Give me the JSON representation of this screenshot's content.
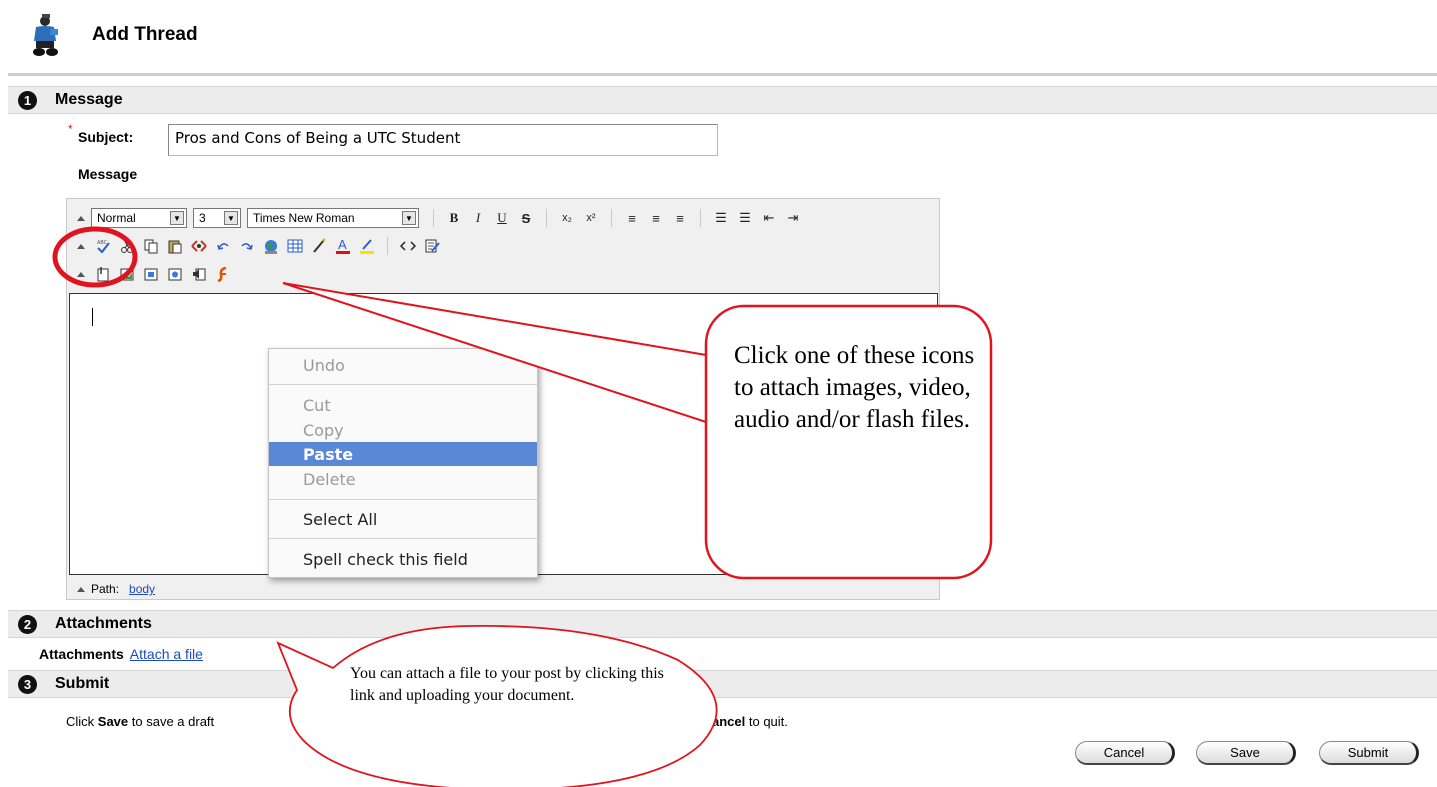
{
  "header": {
    "title": "Add Thread"
  },
  "sections": {
    "message": {
      "number": "1",
      "title": "Message"
    },
    "attachments": {
      "number": "2",
      "title": "Attachments"
    },
    "submit": {
      "number": "3",
      "title": "Submit"
    }
  },
  "subject": {
    "required_mark": "*",
    "label": "Subject:",
    "value": "Pros and Cons of Being a UTC Student"
  },
  "message_label": "Message",
  "toolbar": {
    "format_select": "Normal",
    "size_select": "3",
    "font_select": "Times New Roman",
    "row1_buttons": [
      "B",
      "I",
      "U",
      "S",
      "x₂",
      "x²",
      "≡",
      "≡",
      "≡",
      "☰",
      "☰",
      "⇤",
      "⇥"
    ],
    "row2_icons": [
      "spellcheck-icon",
      "cut-icon",
      "copy-icon",
      "paste-icon",
      "link-icon",
      "undo-icon",
      "redo-icon",
      "globe-icon",
      "table-icon",
      "pen-icon",
      "font-color-icon",
      "highlight-icon",
      "code-icon",
      "edit-icon"
    ],
    "row3_icons": [
      "attach-file-icon",
      "image-icon",
      "media-icon",
      "video-icon",
      "audio-icon",
      "flash-icon"
    ]
  },
  "editor": {
    "path_label": "Path:",
    "path_value": "body"
  },
  "context_menu": {
    "items": [
      {
        "label": "Undo",
        "state": "disabled"
      },
      {
        "label": "Cut",
        "state": "disabled"
      },
      {
        "label": "Copy",
        "state": "disabled"
      },
      {
        "label": "Paste",
        "state": "selected"
      },
      {
        "label": "Delete",
        "state": "disabled"
      },
      {
        "label": "Select All",
        "state": "enabled"
      },
      {
        "label": "Spell check this field",
        "state": "enabled"
      }
    ]
  },
  "attachments_row": {
    "label": "Attachments",
    "link": "Attach a file"
  },
  "submit_instructions": {
    "prefix": "Click ",
    "save_word": "Save",
    "middle": " to save a draft",
    "cancel_fragment": "ancel",
    "suffix": " to quit."
  },
  "buttons": {
    "cancel": "Cancel",
    "save": "Save",
    "submit": "Submit"
  },
  "annotations": {
    "callout": "Click one of these icons to attach images, video, audio and/or flash files.",
    "bubble": "You can attach a file to your post by clicking this link and uploading your document.",
    "annotation_color": "#e0141e"
  }
}
